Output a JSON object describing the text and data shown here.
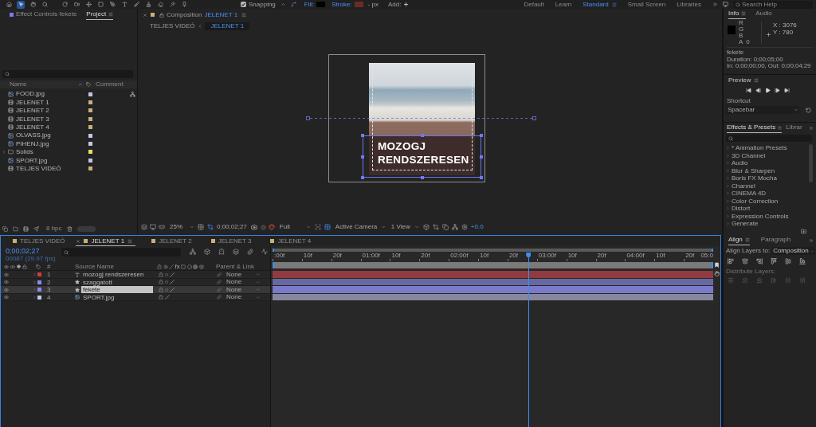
{
  "toolbar": {
    "tools": [
      {
        "selected": false
      },
      {
        "selected": true
      },
      {
        "selected": false
      },
      {
        "selected": false
      },
      {
        "selected": false
      },
      {
        "selected": false
      },
      {
        "selected": false
      },
      {
        "selected": false
      },
      {
        "selected": false
      },
      {
        "selected": false
      },
      {
        "selected": false
      },
      {
        "selected": false
      },
      {
        "selected": false
      },
      {
        "selected": false
      },
      {
        "selected": false
      }
    ],
    "snapping": {
      "label": "Snapping",
      "checked": true
    },
    "swatches": [
      {
        "label": "Fill:",
        "color": "#000000"
      },
      {
        "label": "Stroke:",
        "color": "#6b2b25"
      }
    ],
    "stroke_width": "- px",
    "add_label": "Add:",
    "workspaces": [
      {
        "label": "Default",
        "selected": false
      },
      {
        "label": "Learn",
        "selected": false
      },
      {
        "label": "Standard",
        "selected": true
      },
      {
        "label": "Small Screen",
        "selected": false
      },
      {
        "label": "Libraries",
        "selected": false
      }
    ],
    "search": {
      "placeholder": "Search Help"
    }
  },
  "project_panel": {
    "tabs": [
      {
        "label": "Effect Controls fekete",
        "selected": false
      },
      {
        "label": "Project",
        "selected": true
      }
    ],
    "columns": [
      "Name",
      "Comment"
    ],
    "items": [
      {
        "name": "FOOD.jpg",
        "kind": "image",
        "color": "#c4c4e8"
      },
      {
        "name": "JELENET 1",
        "kind": "composition",
        "color": "#c8b07c"
      },
      {
        "name": "JELENET 2",
        "kind": "composition",
        "color": "#c8b07c"
      },
      {
        "name": "JELENET 3",
        "kind": "composition",
        "color": "#c8b07c"
      },
      {
        "name": "JELENET 4",
        "kind": "composition",
        "color": "#c8b07c"
      },
      {
        "name": "OLVASS.jpg",
        "kind": "image",
        "color": "#c4c4e8"
      },
      {
        "name": "PIHENJ.jpg",
        "kind": "image",
        "color": "#c4c4e8"
      },
      {
        "name": "Solids",
        "kind": "folder",
        "color": "#e8e05c",
        "expanded": false
      },
      {
        "name": "SPORT.jpg",
        "kind": "image",
        "color": "#c4c4e8"
      },
      {
        "name": "TELJES VIDEÓ",
        "kind": "composition",
        "color": "#c8b07c"
      }
    ],
    "bit_depth": "8 bpc"
  },
  "composition_panel": {
    "title": "Composition",
    "comp_name": "JELENET 1",
    "breadcrumbs": [
      {
        "label": "TELJES VIDEÓ",
        "selected": false
      },
      {
        "label": "JELENET 1",
        "selected": true
      }
    ],
    "overlay_text": "MOZOGJ RENDSZERESEN",
    "footer": {
      "zoom": "25%",
      "timecode": "0;00;02;27",
      "resolution": "Full",
      "camera": "Active Camera",
      "views": "1 View",
      "exposure": "+0.0"
    }
  },
  "info_panel": {
    "tabs": [
      {
        "label": "Info",
        "selected": true
      },
      {
        "label": "Audio",
        "selected": false
      }
    ],
    "channels": [
      {
        "label": "R"
      },
      {
        "label": "G"
      },
      {
        "label": "B"
      },
      {
        "label": "A",
        "value": "0"
      }
    ],
    "position": [
      "X : 3076",
      "Y : 780"
    ],
    "details": [
      "fekete",
      "Duration: 0;00;05;00",
      "In: 0;00;00;00, Out: 0;00;04;29"
    ]
  },
  "preview_panel": {
    "title": "Preview",
    "shortcut_label": "Shortcut",
    "shortcut": "Spacebar"
  },
  "effects_panel": {
    "tabs": [
      {
        "label": "Effects & Presets",
        "selected": true
      },
      {
        "label": "Librar",
        "selected": false
      }
    ],
    "categories": [
      "* Animation Presets",
      "3D Channel",
      "Audio",
      "Blur & Sharpen",
      "Boris FX Mocha",
      "Channel",
      "CINEMA 4D",
      "Color Correction",
      "Distort",
      "Expression Controls",
      "Generate"
    ]
  },
  "timeline": {
    "tabs": [
      {
        "label": "TELJES VIDEÓ",
        "selected": false
      },
      {
        "label": "JELENET 1",
        "selected": true
      },
      {
        "label": "JELENET 2",
        "selected": false
      },
      {
        "label": "JELENET 3",
        "selected": false
      },
      {
        "label": "JELENET 4",
        "selected": false
      }
    ],
    "timecode": "0;00;02;27",
    "frame_info": "00087 (29.97 fps)",
    "columns": {
      "number": "#",
      "source_name": "Source Name",
      "effects": "fx",
      "parent": "Parent & Link"
    },
    "layers": [
      {
        "number": "1",
        "kind": "text",
        "name": "mozogj rendszeresen",
        "color": "#d43c3c",
        "selected": false,
        "parent": "None"
      },
      {
        "number": "2",
        "kind": "shape",
        "name": "szaggatott",
        "color": "#8c8cf0",
        "selected": false,
        "parent": "None"
      },
      {
        "number": "3",
        "kind": "shape",
        "name": "fekete",
        "color": "#8c8cf0",
        "selected": true,
        "parent": "None"
      },
      {
        "number": "4",
        "kind": "image",
        "name": "SPORT.jpg",
        "color": "#c4c4e8",
        "selected": false,
        "parent": "None"
      }
    ],
    "ruler": [
      ":00f",
      "10f",
      "20f",
      "01:00f",
      "10f",
      "20f",
      "02:00f",
      "10f",
      "20f",
      "03:00f",
      "10f",
      "20f",
      "04:00f",
      "10f",
      "20f",
      "05:0"
    ],
    "playhead": {
      "level": 0.58
    }
  },
  "align_panel": {
    "tabs": [
      {
        "label": "Align",
        "selected": true
      },
      {
        "label": "Paragraph",
        "selected": false
      }
    ],
    "align_to_label": "Align Layers to:",
    "align_to": "Composition",
    "distribute": {
      "label": "Distribute Layers:",
      "disabled": true
    }
  }
}
